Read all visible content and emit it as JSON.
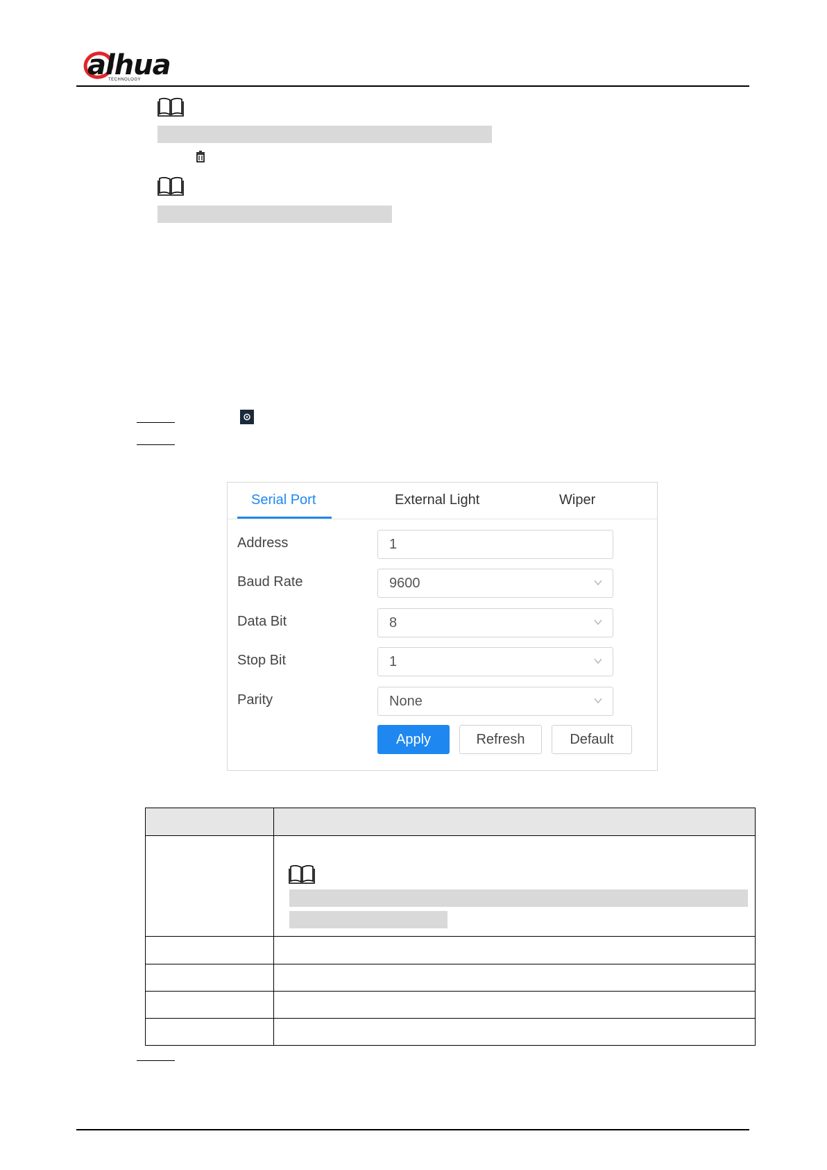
{
  "header": {
    "brand": "alhua",
    "brand_sub": "TECHNOLOGY"
  },
  "panel": {
    "tabs": [
      {
        "label": "Serial Port"
      },
      {
        "label": "External Light"
      },
      {
        "label": "Wiper"
      }
    ],
    "active_tab": "Serial Port",
    "fields": {
      "address": {
        "label": "Address",
        "value": "1"
      },
      "baud_rate": {
        "label": "Baud Rate",
        "value": "9600"
      },
      "data_bit": {
        "label": "Data Bit",
        "value": "8"
      },
      "stop_bit": {
        "label": "Stop Bit",
        "value": "1"
      },
      "parity": {
        "label": "Parity",
        "value": "None"
      }
    },
    "buttons": {
      "apply": "Apply",
      "refresh": "Refresh",
      "default": "Default"
    }
  },
  "colors": {
    "accent": "#1e88f0",
    "redaction": "#d9d9d9",
    "table_header": "#e6e6e6"
  },
  "icons": [
    "note-book-icon",
    "trash-icon",
    "settings-icon",
    "chevron-down-icon"
  ]
}
